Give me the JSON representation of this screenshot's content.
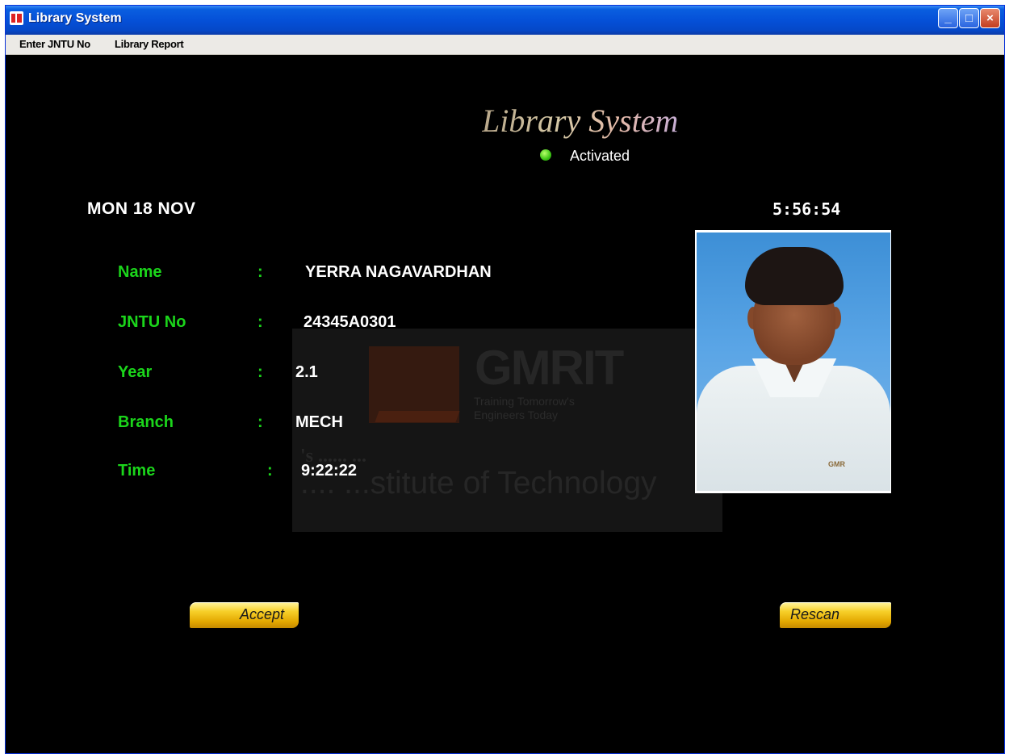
{
  "window": {
    "title": "Library System"
  },
  "menu": [
    "Enter JNTU No",
    "Library Report"
  ],
  "heading": "Library System",
  "status": {
    "text": "Activated",
    "color": "#3bc414"
  },
  "date": "MON 18 NOV",
  "clock": "5:56:54",
  "fields": {
    "name": {
      "label": "Name",
      "value": "YERRA NAGAVARDHAN"
    },
    "jntu": {
      "label": "JNTU No",
      "value": "24345A0301"
    },
    "year": {
      "label": "Year",
      "value": "2.1"
    },
    "branch": {
      "label": "Branch",
      "value": "MECH"
    },
    "time": {
      "label": "Time",
      "value": "9:22:22"
    },
    "colon": ":"
  },
  "watermark": {
    "name": "GMRIT",
    "tagline1": "Training Tomorrow's",
    "tagline2": "Engineers Today",
    "line1": "'s ...... ...",
    "line2": ".... ...stitute of Technology"
  },
  "photo_badge": "GMR",
  "buttons": {
    "accept": "Accept",
    "rescan": "Rescan"
  },
  "colors": {
    "label_green": "#1bd51b",
    "titlebar_blue": "#0550d8",
    "button_gold": "#f7d02a"
  }
}
